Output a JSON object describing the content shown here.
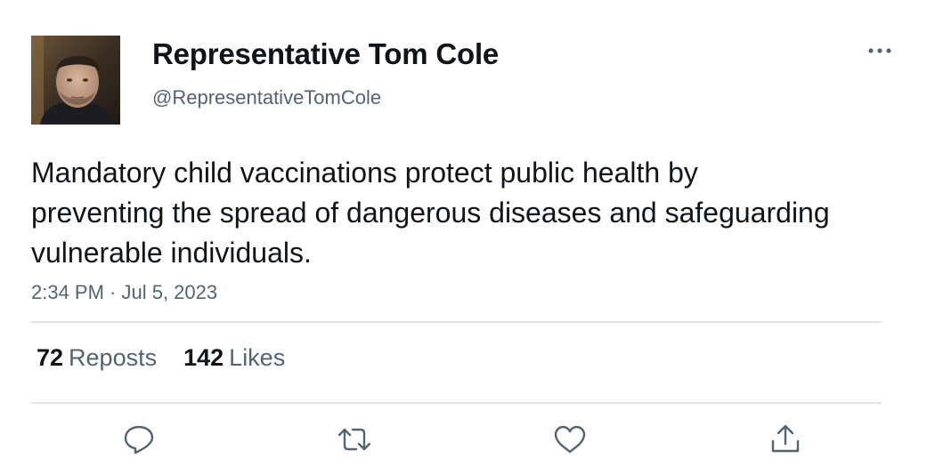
{
  "tweet": {
    "author": {
      "display_name": "Representative Tom Cole",
      "handle": "@RepresentativeTomCole"
    },
    "text": "Mandatory child vaccinations protect public health by preventing the spread of dangerous diseases and safeguarding vulnerable individuals.",
    "timestamp": "2:34 PM · Jul 5, 2023",
    "stats": {
      "reposts_count": "72",
      "reposts_label": "Reposts",
      "likes_count": "142",
      "likes_label": "Likes"
    },
    "icons": {
      "more": "more-dots-icon",
      "reply": "reply-icon",
      "repost": "repost-icon",
      "like": "heart-icon",
      "share": "share-icon"
    }
  },
  "colors": {
    "text_primary": "#0f1419",
    "text_secondary": "#536471",
    "divider": "#e1e4e7"
  }
}
